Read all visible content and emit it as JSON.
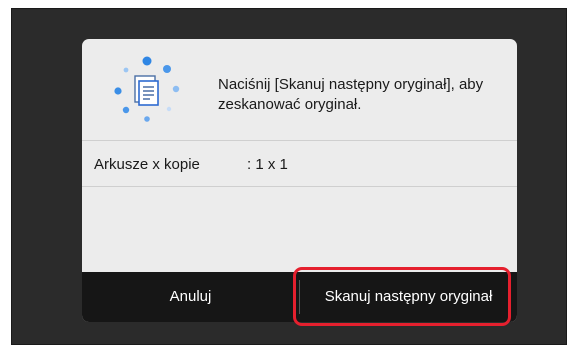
{
  "dialog": {
    "icon": "scanning-document-icon",
    "message": "Naciśnij [Skanuj następny oryginał], aby zeskanować oryginał.",
    "info": {
      "label": "Arkusze x kopie",
      "value": ": 1 x 1"
    }
  },
  "buttons": {
    "cancel_label": "Anuluj",
    "next_label": "Skanuj następny oryginał"
  },
  "colors": {
    "screen_bg": "#2b2b2b",
    "dialog_bg": "#ececec",
    "footer_bg": "#161616",
    "highlight": "#e5202e",
    "icon_blue": "#3a8ee6"
  }
}
